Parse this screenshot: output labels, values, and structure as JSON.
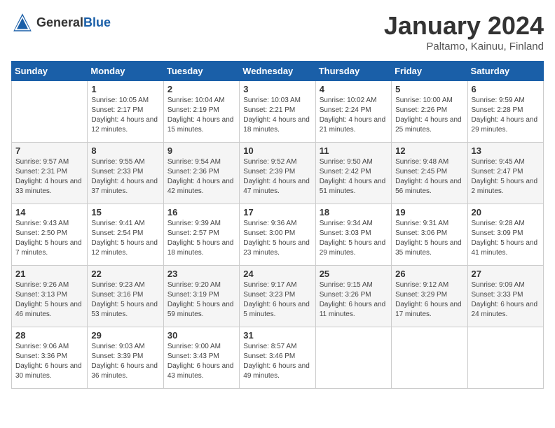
{
  "header": {
    "logo_general": "General",
    "logo_blue": "Blue",
    "month_title": "January 2024",
    "location": "Paltamo, Kainuu, Finland"
  },
  "days_of_week": [
    "Sunday",
    "Monday",
    "Tuesday",
    "Wednesday",
    "Thursday",
    "Friday",
    "Saturday"
  ],
  "weeks": [
    [
      {
        "day": "",
        "sunrise": "",
        "sunset": "",
        "daylight": ""
      },
      {
        "day": "1",
        "sunrise": "Sunrise: 10:05 AM",
        "sunset": "Sunset: 2:17 PM",
        "daylight": "Daylight: 4 hours and 12 minutes."
      },
      {
        "day": "2",
        "sunrise": "Sunrise: 10:04 AM",
        "sunset": "Sunset: 2:19 PM",
        "daylight": "Daylight: 4 hours and 15 minutes."
      },
      {
        "day": "3",
        "sunrise": "Sunrise: 10:03 AM",
        "sunset": "Sunset: 2:21 PM",
        "daylight": "Daylight: 4 hours and 18 minutes."
      },
      {
        "day": "4",
        "sunrise": "Sunrise: 10:02 AM",
        "sunset": "Sunset: 2:24 PM",
        "daylight": "Daylight: 4 hours and 21 minutes."
      },
      {
        "day": "5",
        "sunrise": "Sunrise: 10:00 AM",
        "sunset": "Sunset: 2:26 PM",
        "daylight": "Daylight: 4 hours and 25 minutes."
      },
      {
        "day": "6",
        "sunrise": "Sunrise: 9:59 AM",
        "sunset": "Sunset: 2:28 PM",
        "daylight": "Daylight: 4 hours and 29 minutes."
      }
    ],
    [
      {
        "day": "7",
        "sunrise": "Sunrise: 9:57 AM",
        "sunset": "Sunset: 2:31 PM",
        "daylight": "Daylight: 4 hours and 33 minutes."
      },
      {
        "day": "8",
        "sunrise": "Sunrise: 9:55 AM",
        "sunset": "Sunset: 2:33 PM",
        "daylight": "Daylight: 4 hours and 37 minutes."
      },
      {
        "day": "9",
        "sunrise": "Sunrise: 9:54 AM",
        "sunset": "Sunset: 2:36 PM",
        "daylight": "Daylight: 4 hours and 42 minutes."
      },
      {
        "day": "10",
        "sunrise": "Sunrise: 9:52 AM",
        "sunset": "Sunset: 2:39 PM",
        "daylight": "Daylight: 4 hours and 47 minutes."
      },
      {
        "day": "11",
        "sunrise": "Sunrise: 9:50 AM",
        "sunset": "Sunset: 2:42 PM",
        "daylight": "Daylight: 4 hours and 51 minutes."
      },
      {
        "day": "12",
        "sunrise": "Sunrise: 9:48 AM",
        "sunset": "Sunset: 2:45 PM",
        "daylight": "Daylight: 4 hours and 56 minutes."
      },
      {
        "day": "13",
        "sunrise": "Sunrise: 9:45 AM",
        "sunset": "Sunset: 2:47 PM",
        "daylight": "Daylight: 5 hours and 2 minutes."
      }
    ],
    [
      {
        "day": "14",
        "sunrise": "Sunrise: 9:43 AM",
        "sunset": "Sunset: 2:50 PM",
        "daylight": "Daylight: 5 hours and 7 minutes."
      },
      {
        "day": "15",
        "sunrise": "Sunrise: 9:41 AM",
        "sunset": "Sunset: 2:54 PM",
        "daylight": "Daylight: 5 hours and 12 minutes."
      },
      {
        "day": "16",
        "sunrise": "Sunrise: 9:39 AM",
        "sunset": "Sunset: 2:57 PM",
        "daylight": "Daylight: 5 hours and 18 minutes."
      },
      {
        "day": "17",
        "sunrise": "Sunrise: 9:36 AM",
        "sunset": "Sunset: 3:00 PM",
        "daylight": "Daylight: 5 hours and 23 minutes."
      },
      {
        "day": "18",
        "sunrise": "Sunrise: 9:34 AM",
        "sunset": "Sunset: 3:03 PM",
        "daylight": "Daylight: 5 hours and 29 minutes."
      },
      {
        "day": "19",
        "sunrise": "Sunrise: 9:31 AM",
        "sunset": "Sunset: 3:06 PM",
        "daylight": "Daylight: 5 hours and 35 minutes."
      },
      {
        "day": "20",
        "sunrise": "Sunrise: 9:28 AM",
        "sunset": "Sunset: 3:09 PM",
        "daylight": "Daylight: 5 hours and 41 minutes."
      }
    ],
    [
      {
        "day": "21",
        "sunrise": "Sunrise: 9:26 AM",
        "sunset": "Sunset: 3:13 PM",
        "daylight": "Daylight: 5 hours and 46 minutes."
      },
      {
        "day": "22",
        "sunrise": "Sunrise: 9:23 AM",
        "sunset": "Sunset: 3:16 PM",
        "daylight": "Daylight: 5 hours and 53 minutes."
      },
      {
        "day": "23",
        "sunrise": "Sunrise: 9:20 AM",
        "sunset": "Sunset: 3:19 PM",
        "daylight": "Daylight: 5 hours and 59 minutes."
      },
      {
        "day": "24",
        "sunrise": "Sunrise: 9:17 AM",
        "sunset": "Sunset: 3:23 PM",
        "daylight": "Daylight: 6 hours and 5 minutes."
      },
      {
        "day": "25",
        "sunrise": "Sunrise: 9:15 AM",
        "sunset": "Sunset: 3:26 PM",
        "daylight": "Daylight: 6 hours and 11 minutes."
      },
      {
        "day": "26",
        "sunrise": "Sunrise: 9:12 AM",
        "sunset": "Sunset: 3:29 PM",
        "daylight": "Daylight: 6 hours and 17 minutes."
      },
      {
        "day": "27",
        "sunrise": "Sunrise: 9:09 AM",
        "sunset": "Sunset: 3:33 PM",
        "daylight": "Daylight: 6 hours and 24 minutes."
      }
    ],
    [
      {
        "day": "28",
        "sunrise": "Sunrise: 9:06 AM",
        "sunset": "Sunset: 3:36 PM",
        "daylight": "Daylight: 6 hours and 30 minutes."
      },
      {
        "day": "29",
        "sunrise": "Sunrise: 9:03 AM",
        "sunset": "Sunset: 3:39 PM",
        "daylight": "Daylight: 6 hours and 36 minutes."
      },
      {
        "day": "30",
        "sunrise": "Sunrise: 9:00 AM",
        "sunset": "Sunset: 3:43 PM",
        "daylight": "Daylight: 6 hours and 43 minutes."
      },
      {
        "day": "31",
        "sunrise": "Sunrise: 8:57 AM",
        "sunset": "Sunset: 3:46 PM",
        "daylight": "Daylight: 6 hours and 49 minutes."
      },
      {
        "day": "",
        "sunrise": "",
        "sunset": "",
        "daylight": ""
      },
      {
        "day": "",
        "sunrise": "",
        "sunset": "",
        "daylight": ""
      },
      {
        "day": "",
        "sunrise": "",
        "sunset": "",
        "daylight": ""
      }
    ]
  ]
}
